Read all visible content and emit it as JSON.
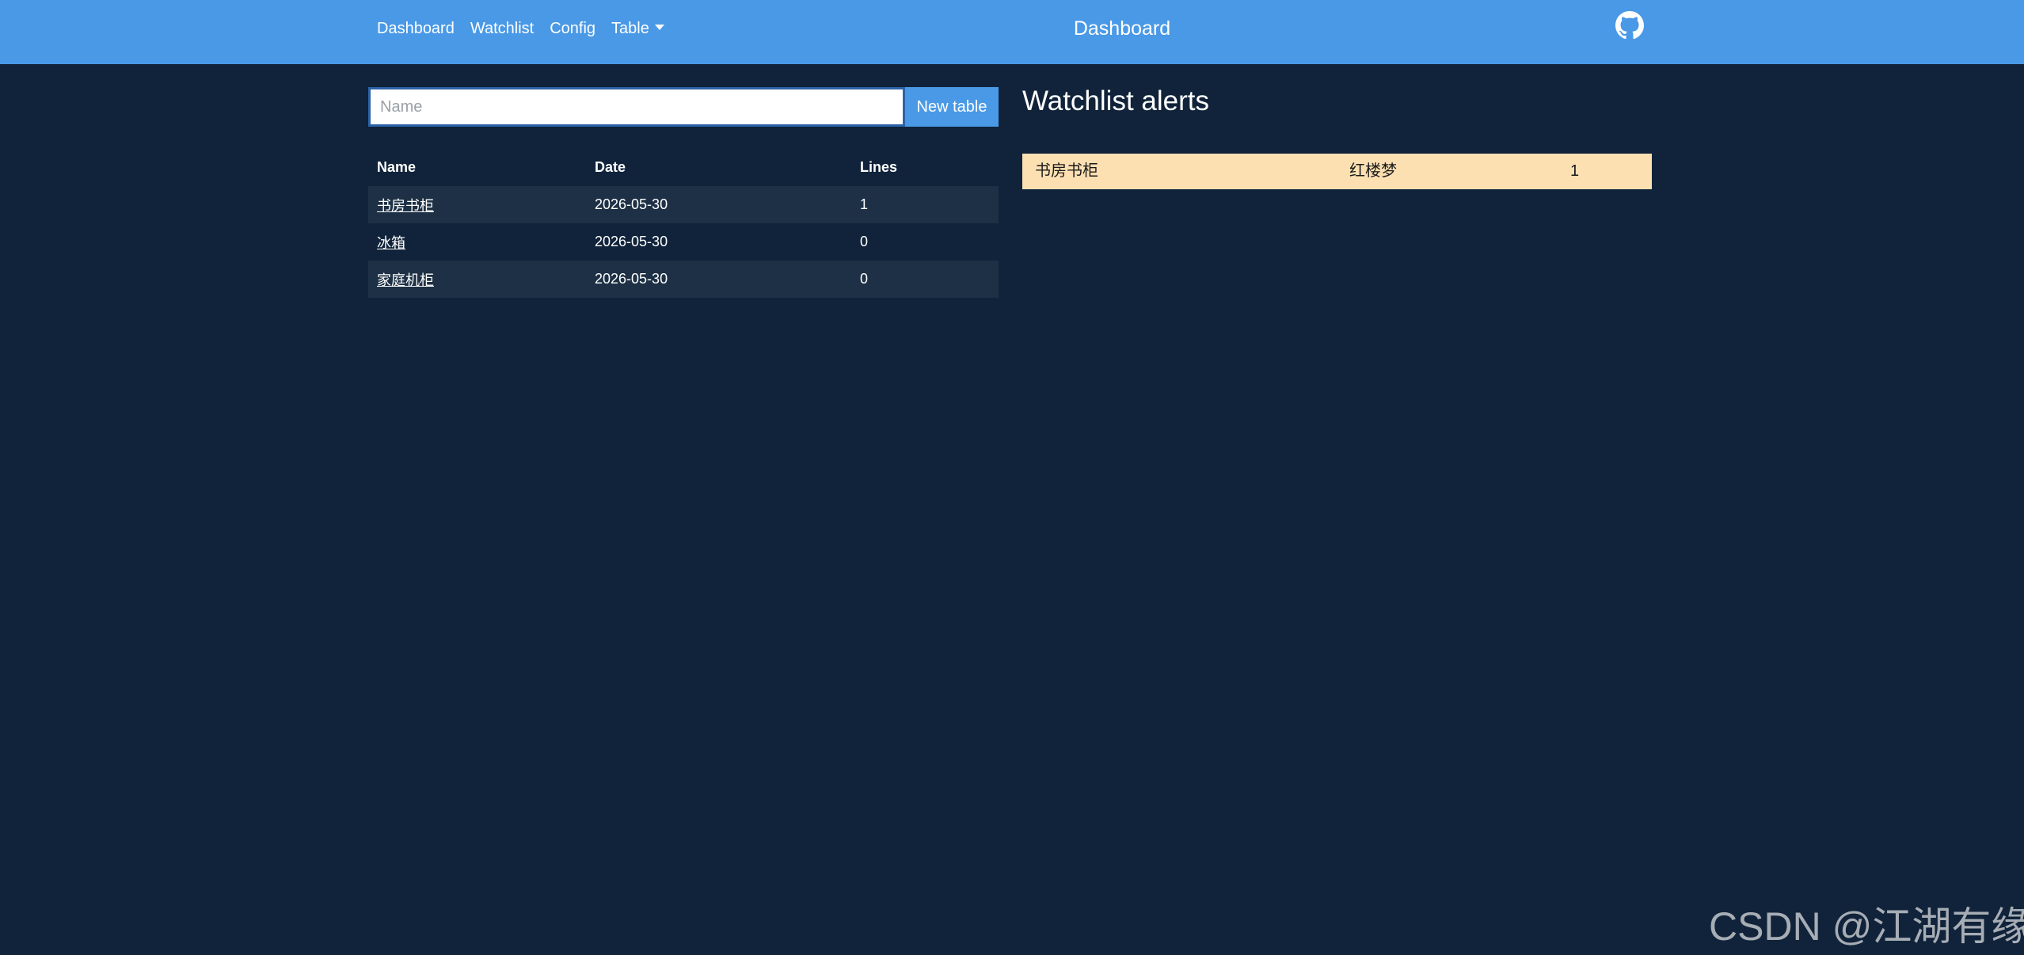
{
  "nav": {
    "links": [
      "Dashboard",
      "Watchlist",
      "Config"
    ],
    "dropdown_label": "Table",
    "title": "Dashboard"
  },
  "form": {
    "placeholder": "Name",
    "button_label": "New table"
  },
  "tables": {
    "headers": [
      "Name",
      "Date",
      "Lines"
    ],
    "rows": [
      [
        "书房书柜",
        "2026-05-30",
        "1"
      ],
      [
        "冰箱",
        "2026-05-30",
        "0"
      ],
      [
        "家庭机柜",
        "2026-05-30",
        "0"
      ]
    ]
  },
  "alerts": {
    "heading": "Watchlist alerts",
    "rows": [
      [
        "书房书柜",
        "红楼梦",
        "1"
      ]
    ]
  },
  "watermark": "CSDN @江湖有缘",
  "colors": {
    "navbar": "#4a99e6",
    "background": "#10233a",
    "alert_row": "#fde0b2"
  }
}
